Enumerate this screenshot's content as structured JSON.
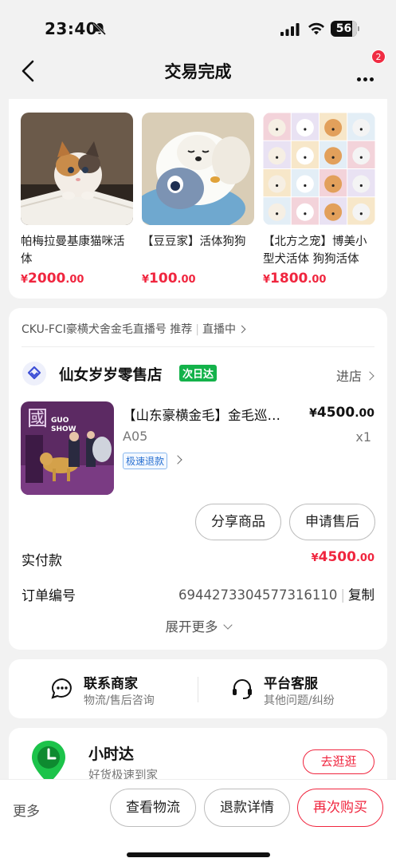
{
  "status_bar": {
    "time": "23:40",
    "battery": "56"
  },
  "nav": {
    "title": "交易完成",
    "badge_count": "2"
  },
  "recommendations": [
    {
      "name": "帕梅拉曼基康猫咪活体",
      "currency": "¥",
      "price_int": "2000",
      "price_dec": ".00"
    },
    {
      "name": "【豆豆家】活体狗狗",
      "currency": "¥",
      "price_int": "100",
      "price_dec": ".00"
    },
    {
      "name": "【北方之宠】博美小型犬活体 狗狗活体",
      "currency": "¥",
      "price_int": "1800",
      "price_dec": ".00"
    }
  ],
  "order": {
    "live_source": "CKU-FCI豪横犬舍金毛直播号 推荐",
    "live_status": "直播中",
    "shop_name": "仙女岁岁零售店",
    "shop_tag": "次日达",
    "enter_shop": "进店",
    "product_title": "【山东豪横金毛】金毛巡回赛冠军",
    "product_currency": "¥",
    "product_price_int": "4500",
    "product_price_dec": ".00",
    "product_spec": "A05",
    "product_qty": "x1",
    "refund_tag": "极速退款",
    "image_text": {
      "big": "國",
      "show": "GUO SHOW"
    },
    "share_button": "分享商品",
    "aftersale_button": "申请售后",
    "paid_label": "实付款",
    "paid_currency": "¥",
    "paid_int": "4500",
    "paid_dec": ".00",
    "order_no_label": "订单编号",
    "order_no": "6944273304577316110",
    "copy_label": "复制",
    "expand_label": "展开更多"
  },
  "contact": {
    "merchant_title": "联系商家",
    "merchant_sub": "物流/售后咨询",
    "service_title": "平台客服",
    "service_sub": "其他问题/纠纷"
  },
  "hour_delivery": {
    "title": "小时达",
    "subtitle": "好货极速到家",
    "button": "去逛逛"
  },
  "bottom_bar": {
    "more": "更多",
    "logistics": "查看物流",
    "refund_detail": "退款详情",
    "buy_again": "再次购买"
  },
  "colors": {
    "accent_red": "#f0263f",
    "green_tag": "#13b24a",
    "refund_blue": "#2c73d2"
  }
}
